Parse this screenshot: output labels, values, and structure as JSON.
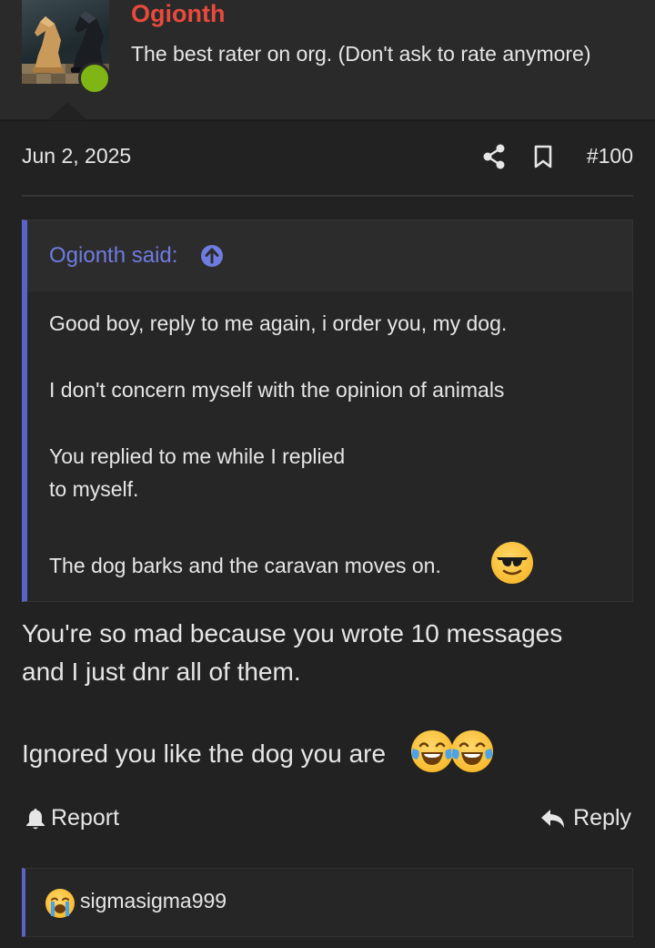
{
  "user": {
    "name": "Ogionth",
    "title": "The best rater on org. (Don't ask to rate anymore)",
    "status": "online"
  },
  "post": {
    "date": "Jun 2, 2025",
    "number": "#100",
    "share_icon": "share-icon",
    "bookmark_icon": "bookmark-icon"
  },
  "quote": {
    "author_label": "Ogionth said:",
    "jump_icon": "arrow-up-circle-icon",
    "lines": [
      "Good boy, reply to me again, i order you, my dog.",
      "I don't concern myself with the opinion of animals",
      "You replied to me while I replied",
      "to myself.",
      "The dog barks and the caravan moves on."
    ],
    "emoji": "sunglasses-emoji"
  },
  "message": {
    "lines": [
      "You're so mad because you wrote 10 messages",
      "and I just dnr all of them.",
      "Ignored you like the dog you are"
    ],
    "emojis": [
      "tears-of-joy-emoji",
      "tears-of-joy-emoji"
    ]
  },
  "actions": {
    "report_label": "Report",
    "reply_label": "Reply"
  },
  "reactions": {
    "emoji": "loudly-crying-emoji",
    "users": "sigmasigma999"
  },
  "colors": {
    "username": "#e84a3c",
    "quote_accent": "#5b63c6",
    "online": "#7fb515",
    "background": "#222222"
  }
}
